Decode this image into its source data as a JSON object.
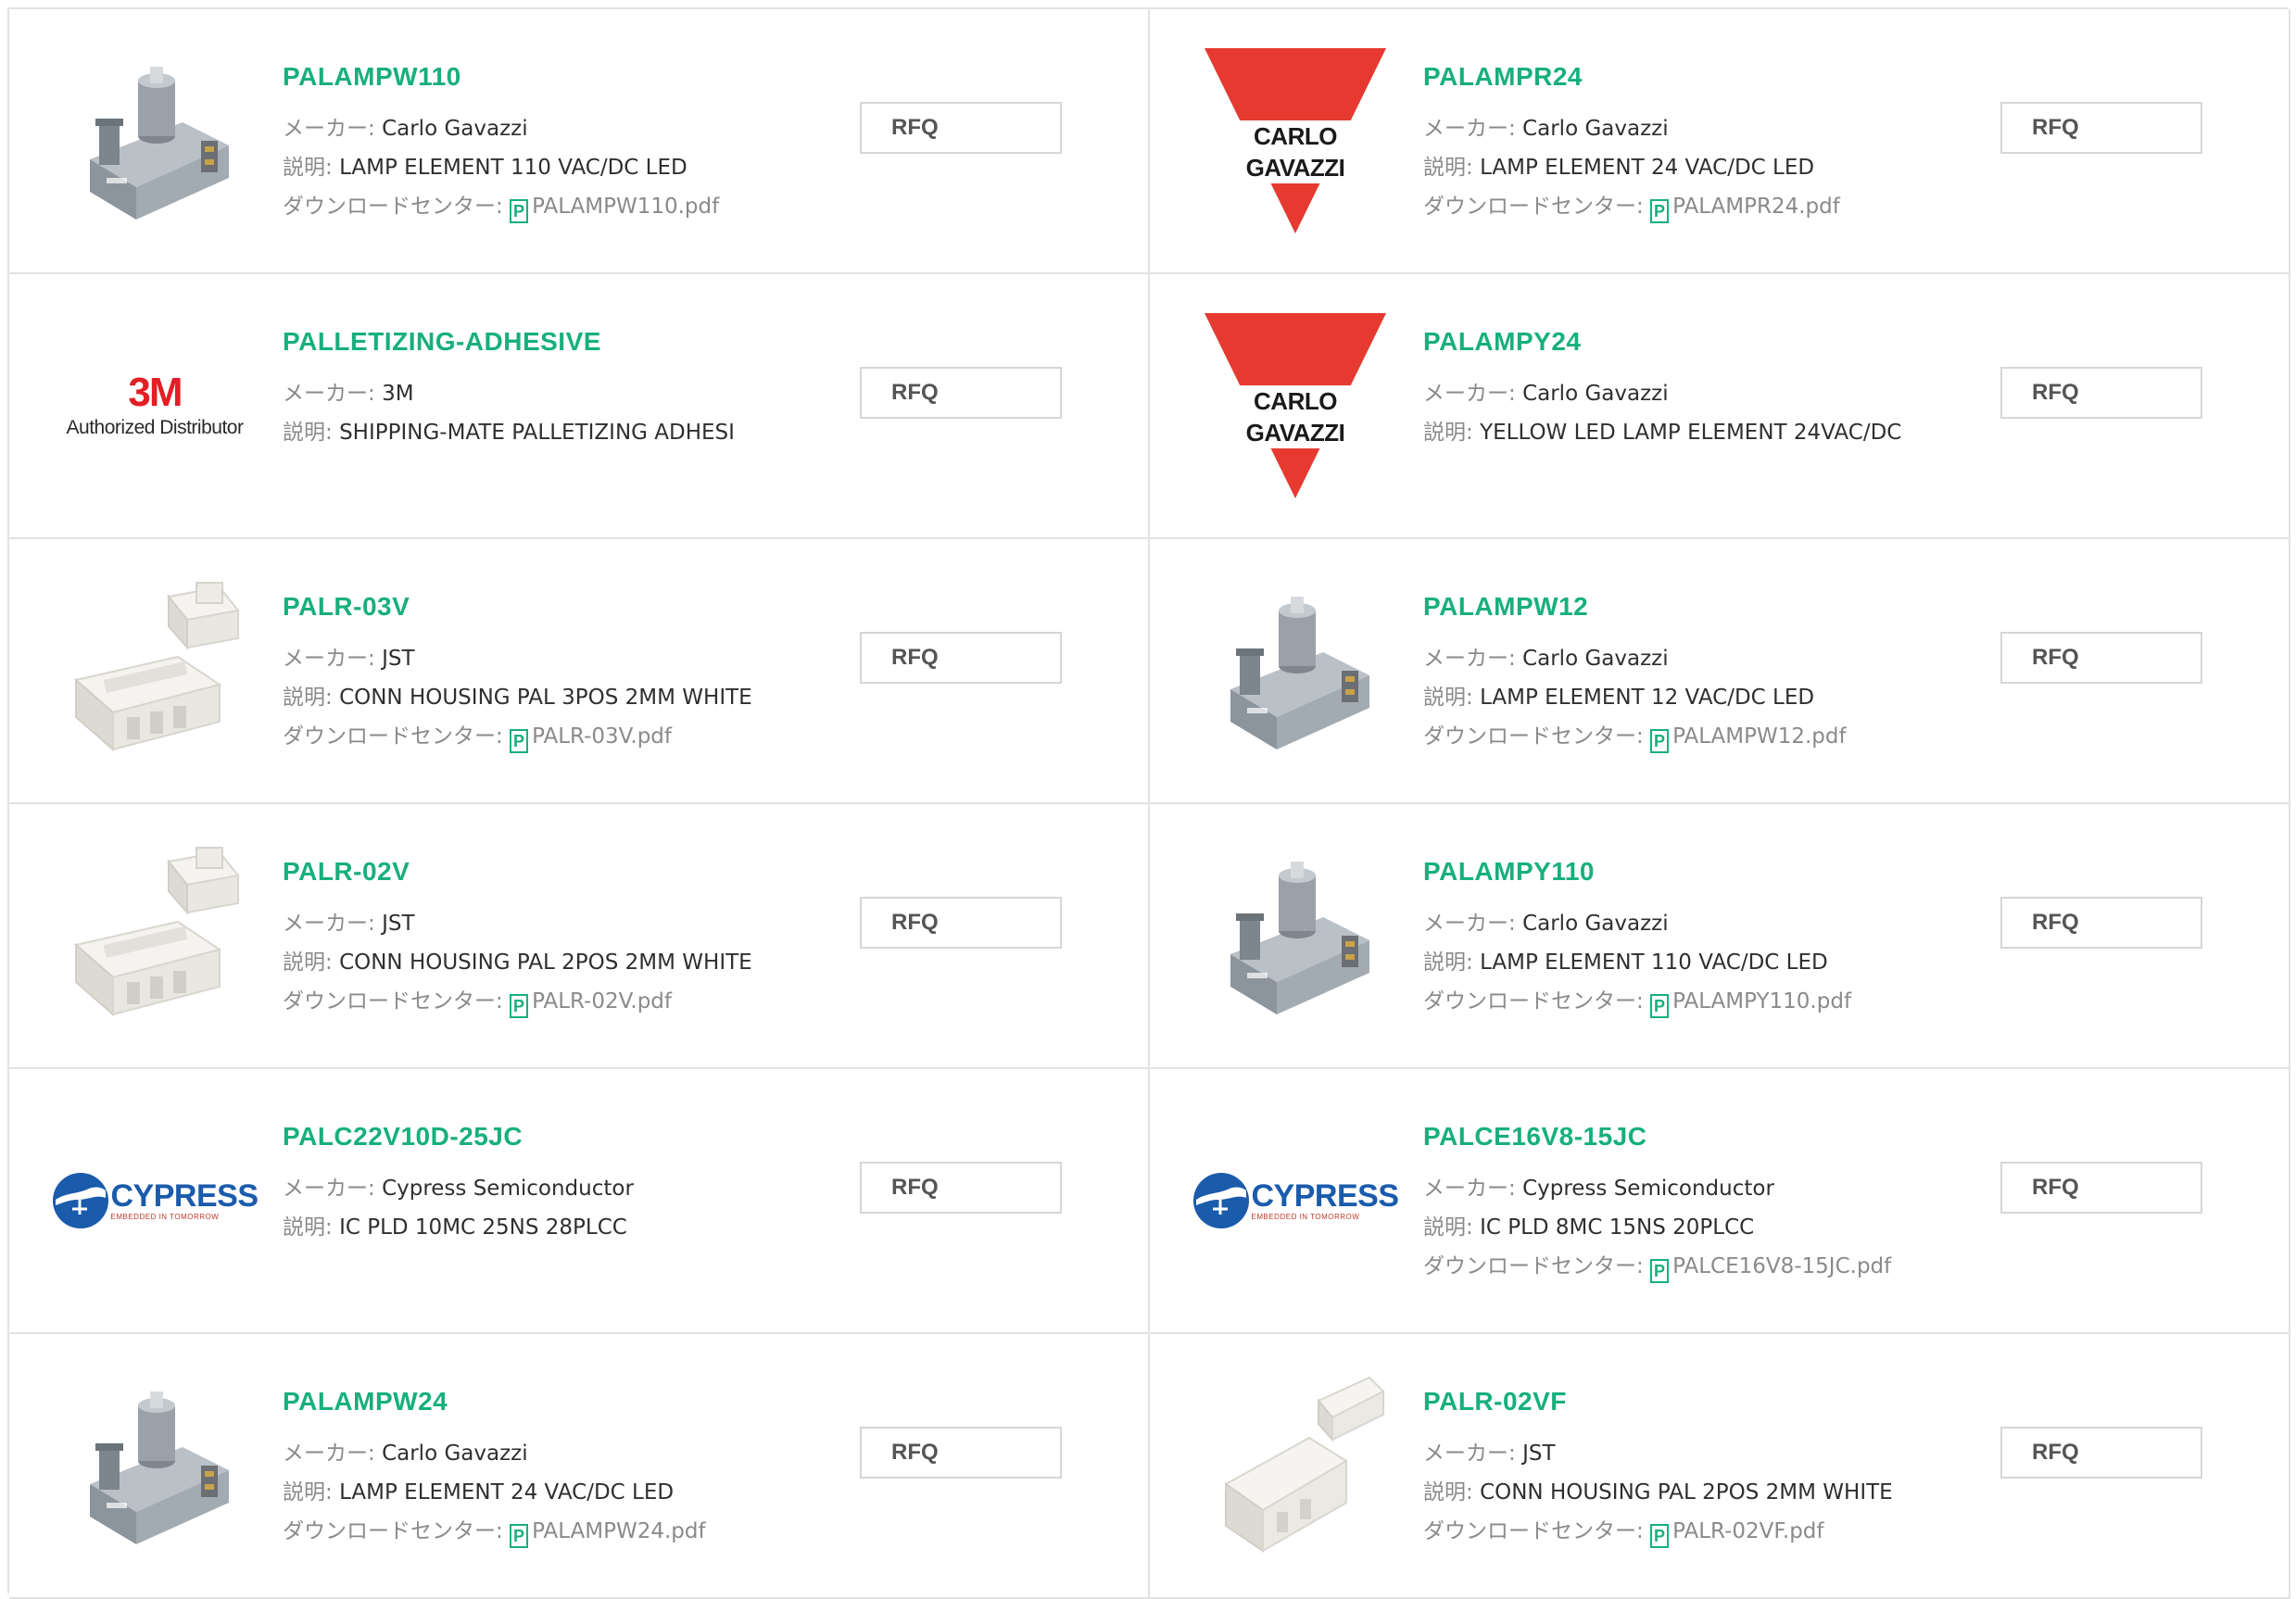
{
  "labels": {
    "maker": "メーカー: ",
    "desc": "説明: ",
    "download": "ダウンロードセンター: ",
    "pdf_icon_letter": "P",
    "rfq": "RFQ"
  },
  "logos": {
    "carlo_gavazzi": "CARLO GAVAZZI",
    "threem_mark": "3M",
    "threem_sub": "Authorized Distributor",
    "cypress_word": "CYPRESS",
    "cypress_tag": "EMBEDDED IN TOMORROW",
    "colors": {
      "accent": "#17b07a",
      "cg_red": "#e63a30",
      "threem_red": "#e31e24",
      "cypress_blue": "#1a5bab"
    }
  },
  "products": [
    {
      "name": "PALAMPW110",
      "maker": "Carlo Gavazzi",
      "desc": "LAMP ELEMENT 110 VAC/DC LED",
      "pdf": "PALAMPW110.pdf",
      "image": "lamp-element-photo"
    },
    {
      "name": "PALAMPR24",
      "maker": "Carlo Gavazzi",
      "desc": "LAMP ELEMENT 24 VAC/DC LED",
      "pdf": "PALAMPR24.pdf",
      "image": "carlo-gavazzi-logo"
    },
    {
      "name": "PALLETIZING-ADHESIVE",
      "maker": "3M",
      "desc": "SHIPPING-MATE PALLETIZING ADHESI",
      "pdf": "",
      "image": "3m-logo"
    },
    {
      "name": "PALAMPY24",
      "maker": "Carlo Gavazzi",
      "desc": "YELLOW LED LAMP ELEMENT 24VAC/DC",
      "pdf": "",
      "image": "carlo-gavazzi-logo"
    },
    {
      "name": "PALR-03V",
      "maker": "JST",
      "desc": "CONN HOUSING PAL 3POS 2MM WHITE",
      "pdf": "PALR-03V.pdf",
      "image": "connector-housing-photo"
    },
    {
      "name": "PALAMPW12",
      "maker": "Carlo Gavazzi",
      "desc": "LAMP ELEMENT 12 VAC/DC LED",
      "pdf": "PALAMPW12.pdf",
      "image": "lamp-element-photo"
    },
    {
      "name": "PALR-02V",
      "maker": "JST",
      "desc": "CONN HOUSING PAL 2POS 2MM WHITE",
      "pdf": "PALR-02V.pdf",
      "image": "connector-housing-photo"
    },
    {
      "name": "PALAMPY110",
      "maker": "Carlo Gavazzi",
      "desc": "LAMP ELEMENT 110 VAC/DC LED",
      "pdf": "PALAMPY110.pdf",
      "image": "lamp-element-photo"
    },
    {
      "name": "PALC22V10D-25JC",
      "maker": "Cypress Semiconductor",
      "desc": "IC PLD 10MC 25NS 28PLCC",
      "pdf": "",
      "image": "cypress-logo"
    },
    {
      "name": "PALCE16V8-15JC",
      "maker": "Cypress Semiconductor",
      "desc": "IC PLD 8MC 15NS 20PLCC",
      "pdf": "PALCE16V8-15JC.pdf",
      "image": "cypress-logo"
    },
    {
      "name": "PALAMPW24",
      "maker": "Carlo Gavazzi",
      "desc": "LAMP ELEMENT 24 VAC/DC LED",
      "pdf": "PALAMPW24.pdf",
      "image": "lamp-element-photo"
    },
    {
      "name": "PALR-02VF",
      "maker": "JST",
      "desc": "CONN HOUSING PAL 2POS 2MM WHITE",
      "pdf": "PALR-02VF.pdf",
      "image": "connector-plug-photo"
    }
  ]
}
